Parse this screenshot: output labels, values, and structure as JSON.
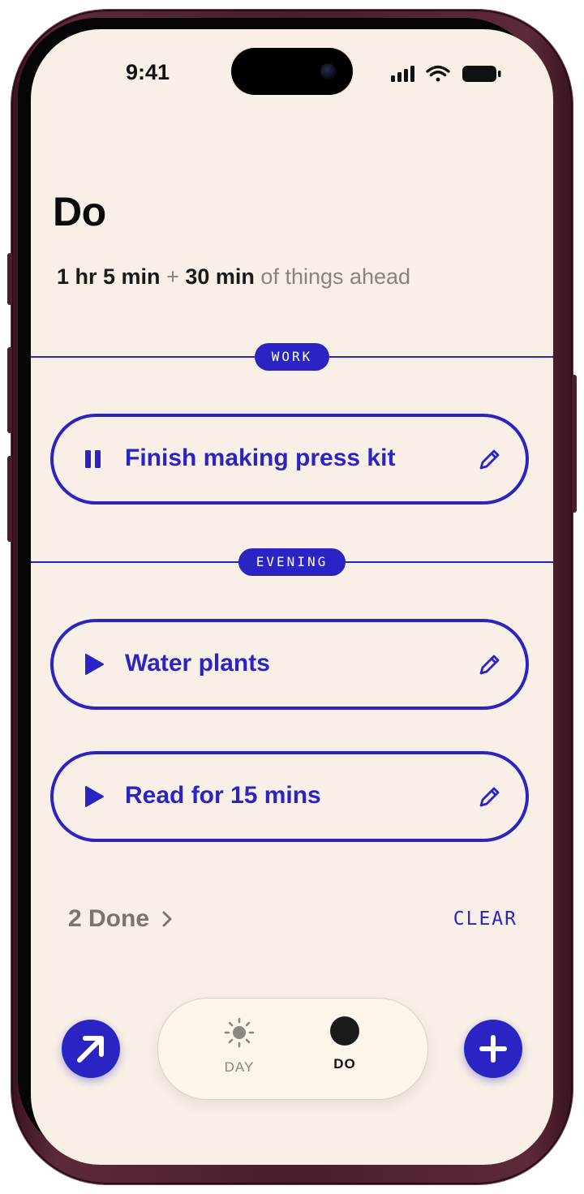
{
  "status_bar": {
    "time": "9:41"
  },
  "page": {
    "title": "Do",
    "summary": {
      "part1": "1 hr 5 min",
      "plus": "+",
      "part2": "30 min",
      "suffix": "of things ahead"
    }
  },
  "sections": [
    {
      "label": "WORK",
      "tasks": [
        {
          "label": "Finish making press kit",
          "state": "playing"
        }
      ]
    },
    {
      "label": "EVENING",
      "tasks": [
        {
          "label": "Water plants",
          "state": "paused"
        },
        {
          "label": "Read for 15 mins",
          "state": "paused"
        }
      ]
    }
  ],
  "done": {
    "label": "2 Done"
  },
  "clear_label": "CLEAR",
  "tabs": [
    {
      "label": "DAY",
      "icon": "sun-icon"
    },
    {
      "label": "DO",
      "icon": "dot-icon"
    }
  ],
  "colors": {
    "accent": "#2a24c4",
    "background": "#f8efe6",
    "frame": "#4a1d2b"
  }
}
